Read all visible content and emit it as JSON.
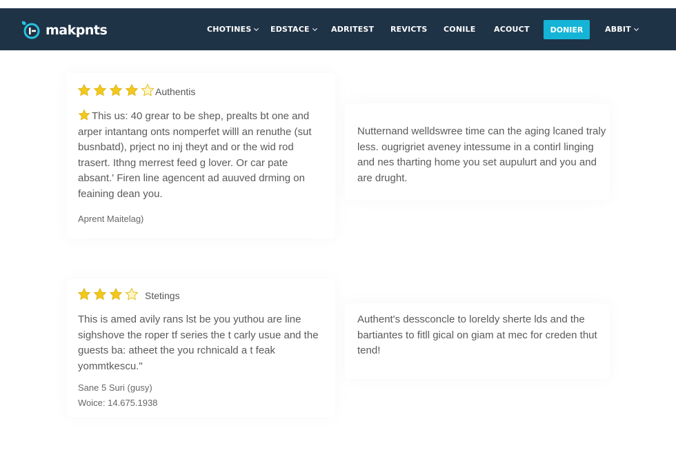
{
  "brand": {
    "name": "makpnts",
    "accent": "#15b4d6",
    "nav_bg": "#1f3347",
    "star_color": "#f2c81c"
  },
  "nav": {
    "items": [
      {
        "label": "CHOTINES",
        "dropdown": true
      },
      {
        "label": "EDSTACE",
        "dropdown": true
      },
      {
        "label": "ADRITEST",
        "dropdown": false
      },
      {
        "label": "REVICTS",
        "dropdown": false
      },
      {
        "label": "CONILE",
        "dropdown": false
      },
      {
        "label": "ACOUCT",
        "dropdown": false
      }
    ],
    "cta_label": "DONIER",
    "last_item": {
      "label": "ABBIT",
      "dropdown": true
    }
  },
  "reviews": [
    {
      "rating": 4,
      "rating_label": "Authentis",
      "text": "This us: 40 grear to be shep, prealts bt one and arper intantang onts nomperfet willl an renuthe (sut busnbatd), prject no inj theyt and or the wid rod trasert. Ithng merrest feed g lover. Or car pate absant.' Firen line agencent ad auuved drming on feaining dean you.",
      "author": "Aprent Maitelag)",
      "meta": ""
    },
    {
      "rating": null,
      "rating_label": "",
      "text": "Nutternand welldswree time can the aging lcaned traly less. ougrigriet aveney intessume in a contirl linging and nes tharting home you set aupulurt and you and are drught.",
      "author": "",
      "meta": ""
    },
    {
      "rating": 3,
      "rating_label": "Stetings",
      "text": "This is amed avily rans lst be you yuthou are line sighshove the roper tf series the t carly usue and the guests ba: atheet the you rchnicald a t feak yommtkescu.\"",
      "author": "Sane 5 Suri (gusy)",
      "meta": "Woice: 14.675.1938"
    },
    {
      "rating": null,
      "rating_label": "",
      "text": "Authent's dessconcle to loreldy sherte lds and the bartiantes to fitll gical on giam at mec for creden thut tend!",
      "author": "",
      "meta": ""
    }
  ]
}
